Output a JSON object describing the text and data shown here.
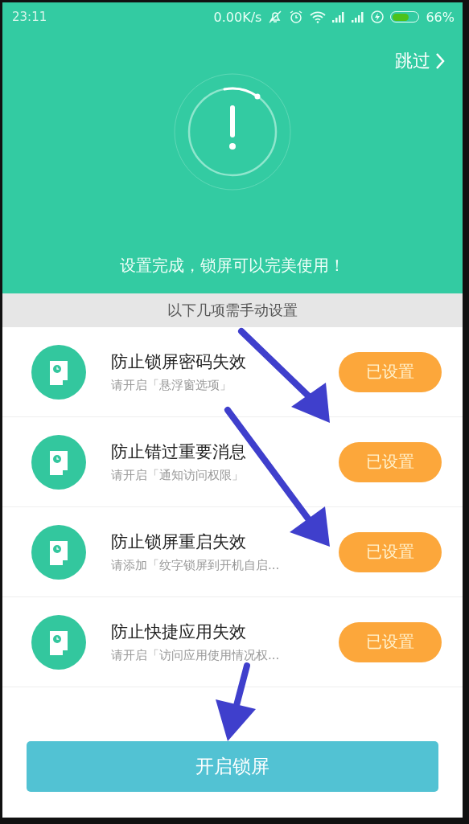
{
  "status_bar": {
    "time": "23:11",
    "net_speed": "0.00K/s",
    "battery_text": "66%",
    "charging": true
  },
  "header": {
    "skip": "跳过",
    "message": "设置完成，锁屏可以完美使用！"
  },
  "section_title": "以下几项需手动设置",
  "items": [
    {
      "title": "防止锁屏密码失效",
      "subtitle": "请开启「悬浮窗选项」",
      "button": "已设置"
    },
    {
      "title": "防止错过重要消息",
      "subtitle": "请开启「通知访问权限」",
      "button": "已设置"
    },
    {
      "title": "防止锁屏重启失效",
      "subtitle": "请添加「纹字锁屏到开机自启...",
      "button": "已设置"
    },
    {
      "title": "防止快捷应用失效",
      "subtitle": "请开启「访问应用使用情况权...",
      "button": "已设置"
    }
  ],
  "main_button": "开启锁屏"
}
